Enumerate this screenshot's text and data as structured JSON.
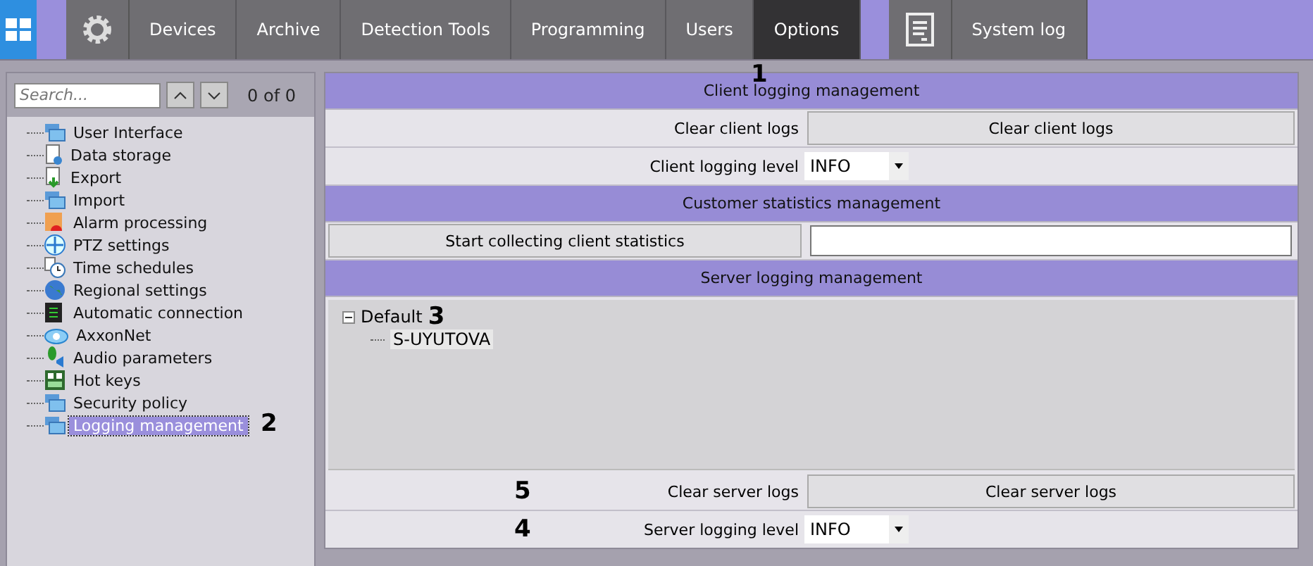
{
  "topbar": {
    "tabs": [
      {
        "label": "Devices",
        "selected": false
      },
      {
        "label": "Archive",
        "selected": false
      },
      {
        "label": "Detection Tools",
        "selected": false
      },
      {
        "label": "Programming",
        "selected": false
      },
      {
        "label": "Users",
        "selected": false
      },
      {
        "label": "Options",
        "selected": true
      }
    ],
    "system_log": "System log"
  },
  "sidebar": {
    "search": {
      "placeholder": "Search..."
    },
    "counter": "0 of 0",
    "items": [
      {
        "label": "User Interface",
        "selected": false
      },
      {
        "label": "Data storage",
        "selected": false
      },
      {
        "label": "Export",
        "selected": false
      },
      {
        "label": "Import",
        "selected": false
      },
      {
        "label": "Alarm processing",
        "selected": false
      },
      {
        "label": "PTZ settings",
        "selected": false
      },
      {
        "label": "Time schedules",
        "selected": false
      },
      {
        "label": "Regional settings",
        "selected": false
      },
      {
        "label": "Automatic connection",
        "selected": false
      },
      {
        "label": "AxxonNet",
        "selected": false
      },
      {
        "label": "Audio parameters",
        "selected": false
      },
      {
        "label": "Hot keys",
        "selected": false
      },
      {
        "label": "Security policy",
        "selected": false
      },
      {
        "label": "Logging management",
        "selected": true
      }
    ]
  },
  "client_logging": {
    "title": "Client logging management",
    "clear_label": "Clear client logs",
    "clear_button": "Clear client logs",
    "level_label": "Client logging level",
    "level_value": "INFO"
  },
  "customer_statistics": {
    "title": "Customer statistics management",
    "start_button": "Start collecting client statistics"
  },
  "server_logging": {
    "title": "Server logging management",
    "tree": [
      {
        "label": "Default",
        "expanded": true,
        "children": [
          {
            "label": "S-UYUTOVA"
          }
        ]
      }
    ],
    "clear_label": "Clear server logs",
    "clear_button": "Clear server logs",
    "level_label": "Server logging level",
    "level_value": "INFO"
  },
  "callouts": [
    "1",
    "2",
    "3",
    "4",
    "5"
  ]
}
